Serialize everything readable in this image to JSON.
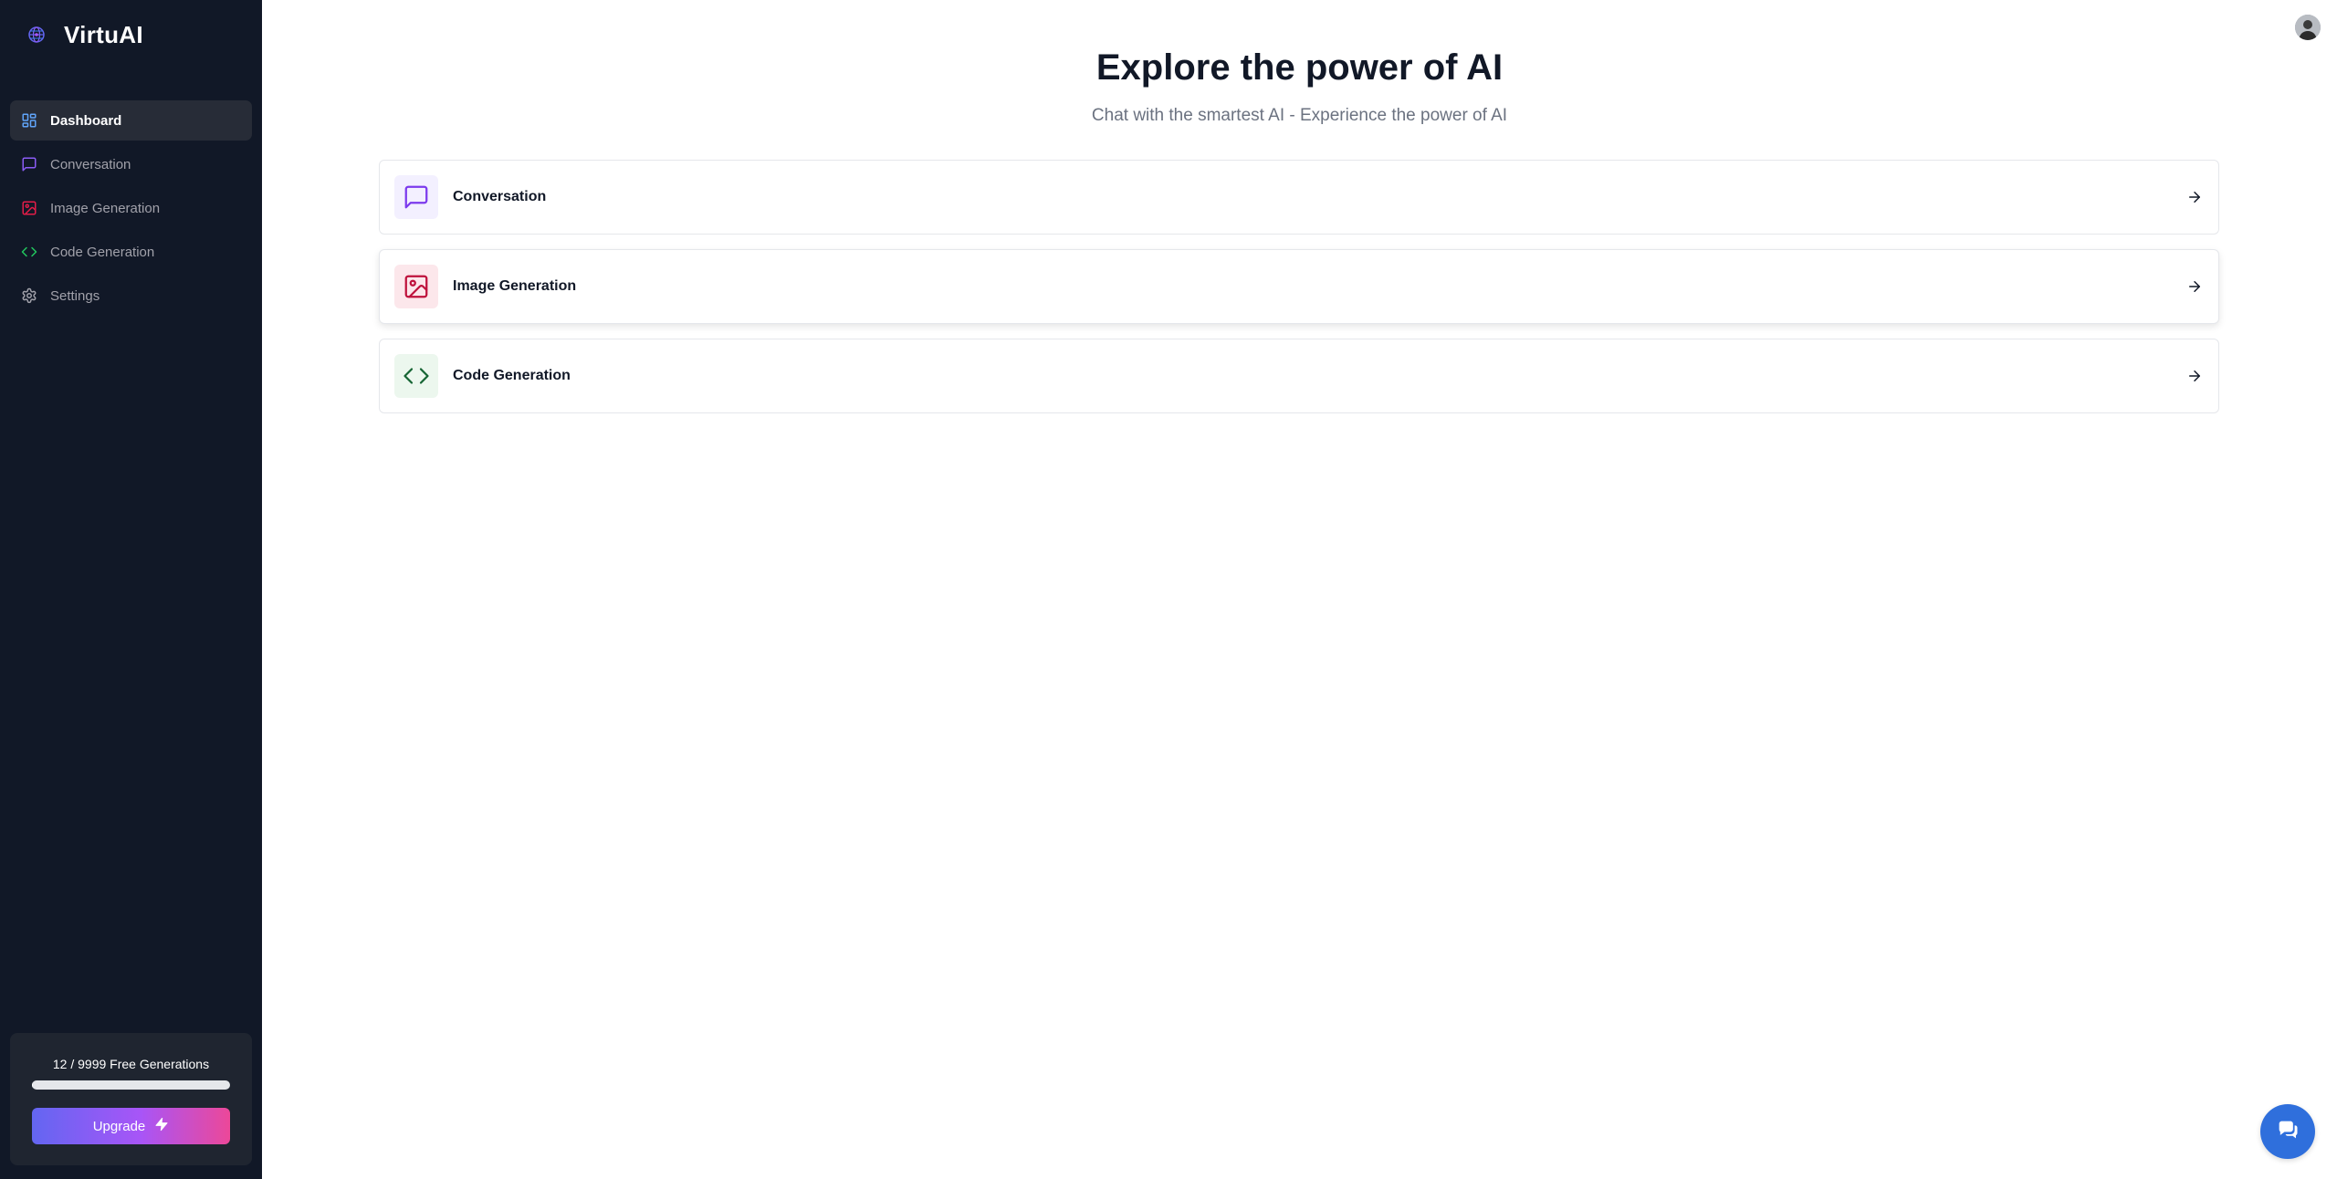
{
  "brand": {
    "name": "VirtuAI",
    "logo_icon": "atom-globe-icon"
  },
  "sidebar": {
    "items": [
      {
        "label": "Dashboard",
        "icon": "dashboard-icon",
        "active": true,
        "color": "#60a5fa"
      },
      {
        "label": "Conversation",
        "icon": "message-square-icon",
        "active": false,
        "color": "#8b5cf6"
      },
      {
        "label": "Image Generation",
        "icon": "image-icon",
        "active": false,
        "color": "#e11d48"
      },
      {
        "label": "Code Generation",
        "icon": "code-icon",
        "active": false,
        "color": "#22c55e"
      },
      {
        "label": "Settings",
        "icon": "gear-icon",
        "active": false,
        "color": "#a1a1aa"
      }
    ],
    "usage": {
      "text": "12 / 9999 Free Generations",
      "used": 12,
      "limit": 9999,
      "upgrade_label": "Upgrade",
      "upgrade_icon": "zap-icon"
    }
  },
  "main": {
    "title": "Explore the power of AI",
    "subtitle": "Chat with the smartest AI - Experience the power of AI",
    "tools": [
      {
        "label": "Conversation",
        "icon": "message-square-icon",
        "color": "#7c3aed",
        "bg": "#f3f0ff"
      },
      {
        "label": "Image Generation",
        "icon": "image-icon",
        "color": "#be123c",
        "bg": "#fce7eb"
      },
      {
        "label": "Code Generation",
        "icon": "code-icon",
        "color": "#166534",
        "bg": "#ecf7ee"
      }
    ]
  },
  "widgets": {
    "avatar_icon": "user-avatar",
    "chat_icon": "chat-bubble-icon",
    "chat_color": "#2f6fdc"
  }
}
